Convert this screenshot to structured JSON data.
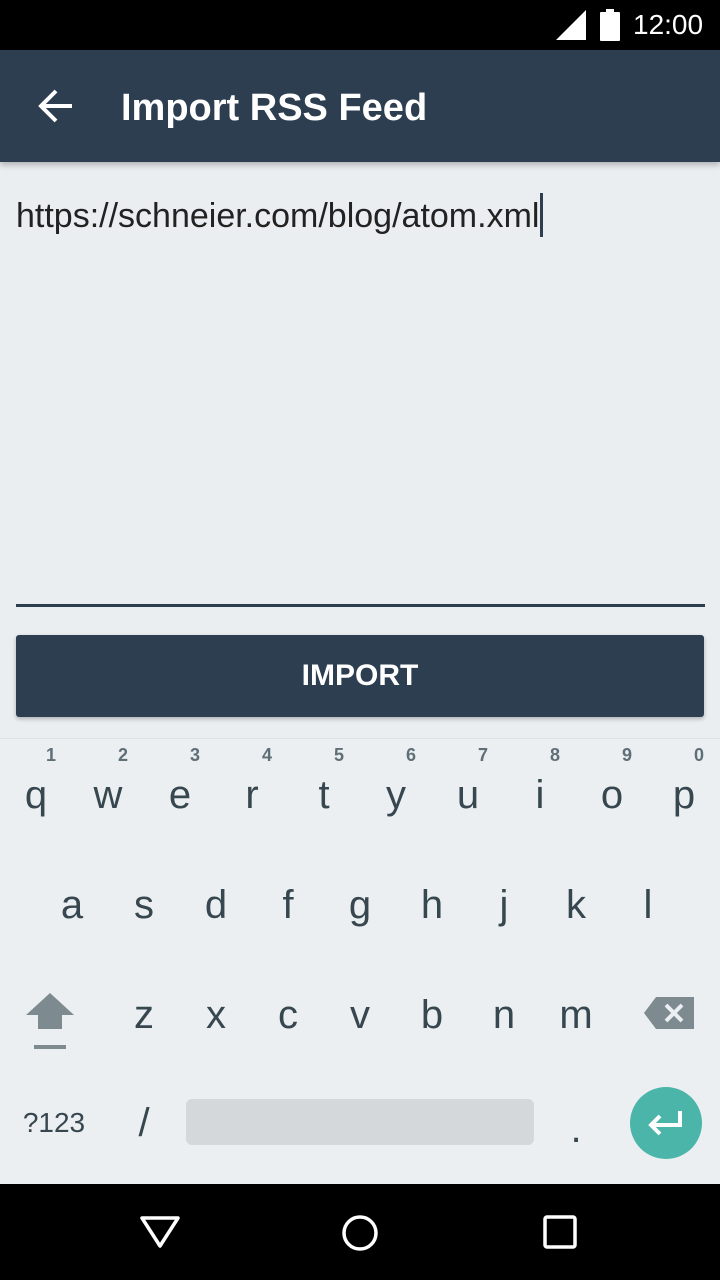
{
  "status_bar": {
    "time": "12:00",
    "icons": [
      "signal-icon",
      "battery-icon"
    ]
  },
  "app_bar": {
    "title": "Import RSS Feed",
    "back_icon": "arrow-left-icon"
  },
  "url_field": {
    "value": "https://schneier.com/blog/atom.xml"
  },
  "import_button": {
    "label": "IMPORT"
  },
  "keyboard": {
    "row1": [
      {
        "key": "q",
        "hint": "1"
      },
      {
        "key": "w",
        "hint": "2"
      },
      {
        "key": "e",
        "hint": "3"
      },
      {
        "key": "r",
        "hint": "4"
      },
      {
        "key": "t",
        "hint": "5"
      },
      {
        "key": "y",
        "hint": "6"
      },
      {
        "key": "u",
        "hint": "7"
      },
      {
        "key": "i",
        "hint": "8"
      },
      {
        "key": "o",
        "hint": "9"
      },
      {
        "key": "p",
        "hint": "0"
      }
    ],
    "row2": [
      "a",
      "s",
      "d",
      "f",
      "g",
      "h",
      "j",
      "k",
      "l"
    ],
    "row3": [
      "z",
      "x",
      "c",
      "v",
      "b",
      "n",
      "m"
    ],
    "symbols_label": "?123",
    "slash_label": "/",
    "period_label": ".",
    "shift_icon": "shift-icon",
    "backspace_icon": "backspace-icon",
    "enter_icon": "enter-icon"
  },
  "nav_bar": {
    "icons": [
      "back-triangle-icon",
      "home-circle-icon",
      "recents-square-icon"
    ]
  },
  "colors": {
    "primary": "#2d3e50",
    "accent": "#4ab5a8",
    "background": "#eaeef1"
  }
}
